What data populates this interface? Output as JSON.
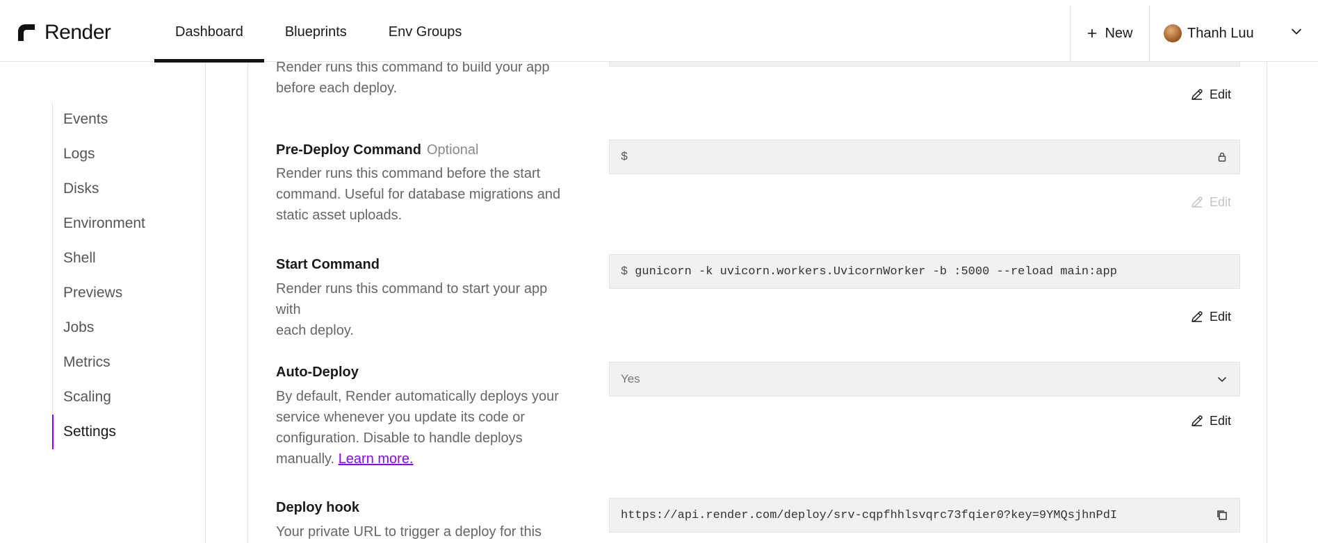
{
  "header": {
    "brand": "Render",
    "nav": [
      {
        "label": "Dashboard",
        "active": true
      },
      {
        "label": "Blueprints",
        "active": false
      },
      {
        "label": "Env Groups",
        "active": false
      }
    ],
    "new_label": "New",
    "user_name": "Thanh Luu"
  },
  "sidebar": {
    "items": [
      {
        "label": "Events"
      },
      {
        "label": "Logs"
      },
      {
        "label": "Disks"
      },
      {
        "label": "Environment"
      },
      {
        "label": "Shell"
      },
      {
        "label": "Previews"
      },
      {
        "label": "Jobs"
      },
      {
        "label": "Metrics"
      },
      {
        "label": "Scaling"
      },
      {
        "label": "Settings",
        "active": true
      }
    ],
    "active_accent": "#8a05ff"
  },
  "settings": {
    "build": {
      "desc_line1": "Render runs this command to build your app",
      "desc_line2": "before each deploy.",
      "edit_label": "Edit"
    },
    "pre_deploy": {
      "label": "Pre-Deploy Command",
      "optional": "Optional",
      "desc_line1": "Render runs this command before the start",
      "desc_line2": "command. Useful for database migrations and",
      "desc_line3": "static asset uploads.",
      "prompt": "$",
      "value": "",
      "edit_label": "Edit",
      "locked": true
    },
    "start": {
      "label": "Start Command",
      "desc_line1": "Render runs this command to start your app with",
      "desc_line2": "each deploy.",
      "prompt": "$",
      "value": "gunicorn -k uvicorn.workers.UvicornWorker -b :5000 --reload main:app",
      "edit_label": "Edit"
    },
    "auto_deploy": {
      "label": "Auto-Deploy",
      "desc_line1": "By default, Render automatically deploys your",
      "desc_line2": "service whenever you update its code or",
      "desc_line3": "configuration. Disable to handle deploys",
      "desc_line4": "manually.",
      "learn_more": "Learn more.",
      "selected": "Yes",
      "edit_label": "Edit"
    },
    "deploy_hook": {
      "label": "Deploy hook",
      "desc_line1": "Your private URL to trigger a deploy for this",
      "url": "https://api.render.com/deploy/srv-cqpfhhlsvqrc73fqier0?key=9YMQsjhnPdI"
    }
  }
}
